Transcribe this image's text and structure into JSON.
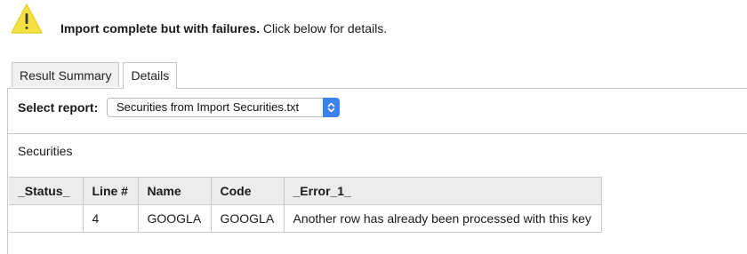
{
  "header": {
    "icon": "warning-icon",
    "icon_color": "#f5e142",
    "message_bold": "Import complete but with failures.",
    "message_rest": " Click below for details."
  },
  "tabs": [
    {
      "label": "Result Summary",
      "active": false
    },
    {
      "label": "Details",
      "active": true
    }
  ],
  "report": {
    "label": "Select report:",
    "selected": "Securities from Import Securities.txt",
    "accent": "#3b82f0"
  },
  "section_title": "Securities",
  "table": {
    "headers": [
      "_Status_",
      "Line #",
      "Name",
      "Code",
      "_Error_1_"
    ],
    "rows": [
      [
        "",
        "4",
        "GOOGLA",
        "GOOGLA",
        "Another row has already been processed with this key"
      ]
    ]
  }
}
